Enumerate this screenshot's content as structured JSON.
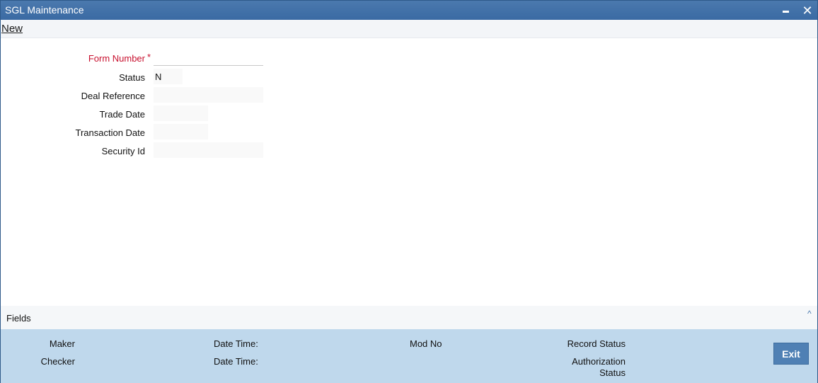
{
  "window": {
    "title": "SGL Maintenance"
  },
  "toolbar": {
    "new_label": "New"
  },
  "form": {
    "form_number": {
      "label": "Form Number",
      "required_mark": "*",
      "value": ""
    },
    "status": {
      "label": "Status",
      "value": "N"
    },
    "deal_reference": {
      "label": "Deal Reference",
      "value": ""
    },
    "trade_date": {
      "label": "Trade Date",
      "value": ""
    },
    "transaction_date": {
      "label": "Transaction Date",
      "value": ""
    },
    "security_id": {
      "label": "Security Id",
      "value": ""
    }
  },
  "fields_bar": {
    "label": "Fields"
  },
  "footer": {
    "maker_label": "Maker",
    "checker_label": "Checker",
    "date_time_label_1": "Date Time:",
    "date_time_label_2": "Date Time:",
    "mod_no_label": "Mod No",
    "record_status_label": "Record Status",
    "authorization_status_label_line1": "Authorization",
    "authorization_status_label_line2": "Status",
    "exit_label": "Exit"
  },
  "colors": {
    "titlebar": "#3a6aa3",
    "required": "#c8102e",
    "footer_bg": "#bfd8ec",
    "exit_button": "#4f80b4"
  },
  "icons": {
    "minimize": "minimize-icon",
    "close": "close-icon",
    "collapse": "chevron-up-icon"
  }
}
